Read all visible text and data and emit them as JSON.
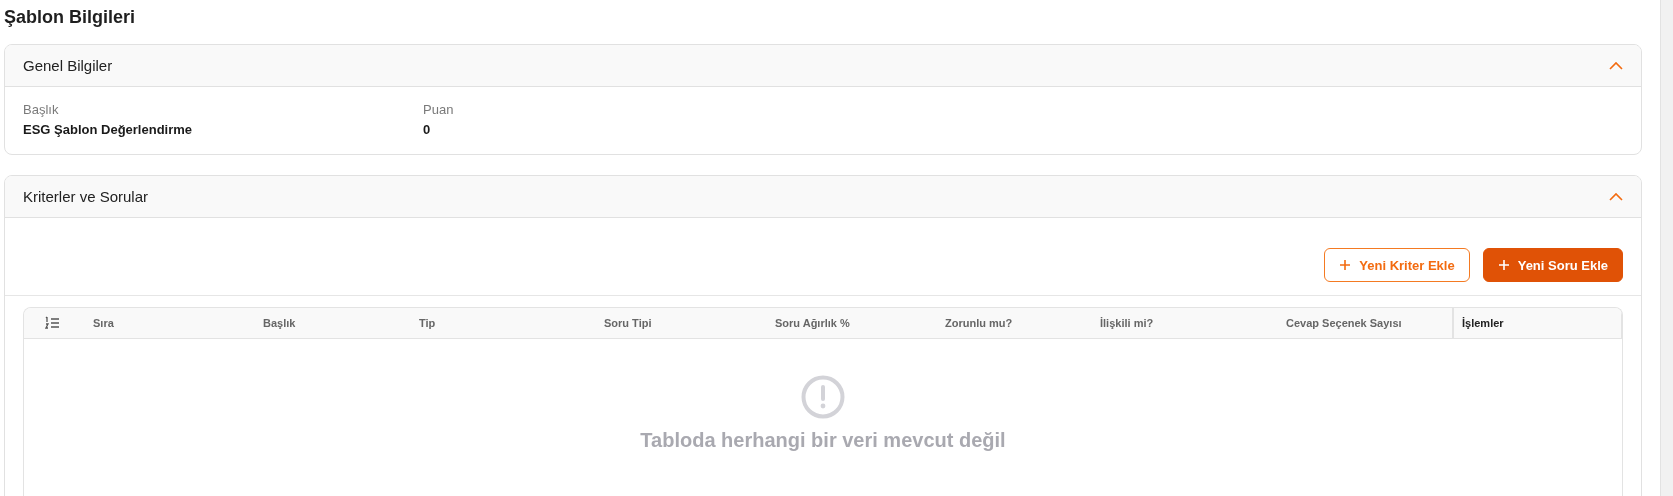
{
  "page_title": "Şablon Bilgileri",
  "general_panel": {
    "title": "Genel Bilgiler",
    "expanded": true,
    "fields": [
      {
        "label": "Başlık",
        "value": "ESG Şablon Değerlendirme"
      },
      {
        "label": "Puan",
        "value": "0"
      }
    ]
  },
  "criteria_panel": {
    "title": "Kriterler ve Sorular",
    "expanded": true,
    "buttons": [
      {
        "label": "Yeni Kriter Ekle",
        "kind": "outline"
      },
      {
        "label": "Yeni Soru Ekle",
        "kind": "primary"
      }
    ],
    "table": {
      "columns": [
        "Sıra",
        "Başlık",
        "Tip",
        "Soru Tipi",
        "Soru Ağırlık %",
        "Zorunlu mu?",
        "İlişkili mi?",
        "Cevap Seçenek Sayısı",
        "İşlemler"
      ],
      "empty_message": "Tabloda herhangi bir veri mevcut değil"
    }
  }
}
